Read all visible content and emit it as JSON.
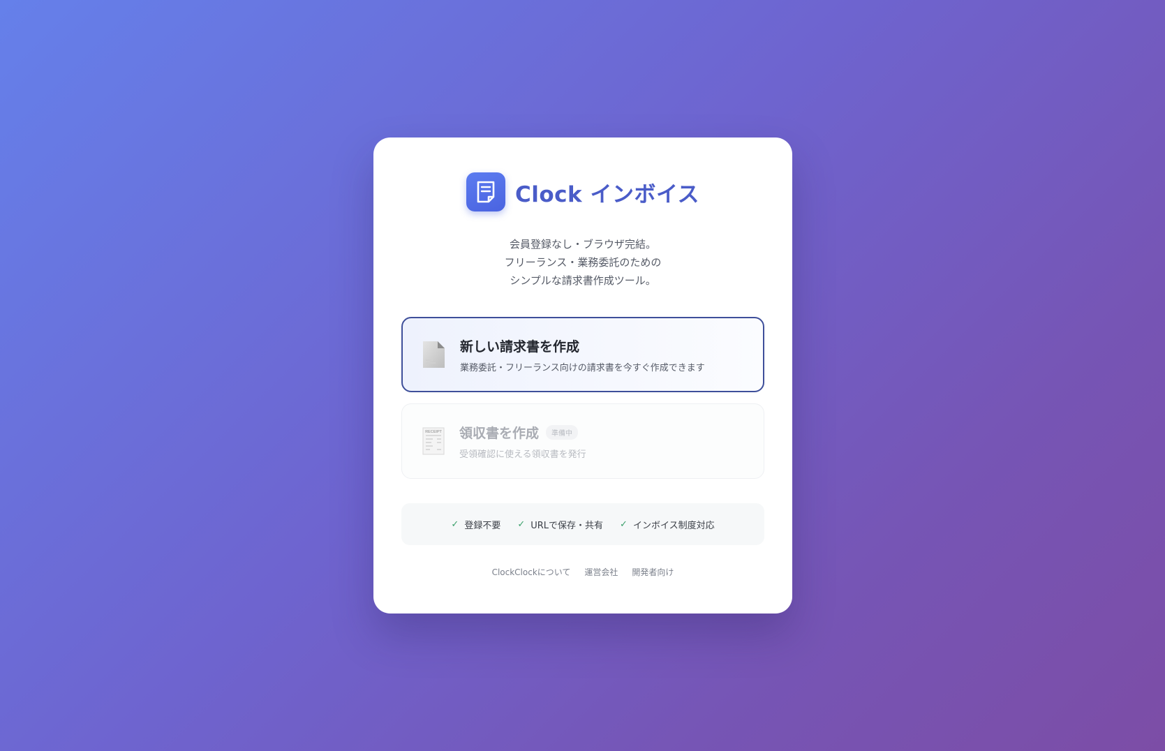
{
  "brand": {
    "name": "Clock インボイス",
    "logo_icon": "document-icon",
    "logo_color": "#4a63e0",
    "name_color": "#4a5cc8"
  },
  "tagline": {
    "lines": [
      "会員登録なし・ブラウザ完結。",
      "フリーランス・業務委託のための",
      "シンプルな請求書作成ツール。"
    ]
  },
  "options": [
    {
      "icon": "invoice-document-icon",
      "title": "新しい請求書を作成",
      "description": "業務委託・フリーランス向けの請求書を今すぐ作成できます",
      "enabled": true
    },
    {
      "icon": "receipt-icon",
      "icon_label": "RECEIPT",
      "title": "領収書を作成",
      "badge": "準備中",
      "description": "受領確認に使える領収書を発行",
      "enabled": false
    }
  ],
  "features": [
    {
      "icon": "check-icon",
      "label": "登録不要"
    },
    {
      "icon": "check-icon",
      "label": "URLで保存・共有"
    },
    {
      "icon": "check-icon",
      "label": "インボイス制度対応"
    }
  ],
  "footer": {
    "links": [
      "ClockClockについて",
      "運営会社",
      "開発者向け"
    ]
  },
  "colors": {
    "accent": "#3e4f9a",
    "check": "#3aa06a"
  }
}
